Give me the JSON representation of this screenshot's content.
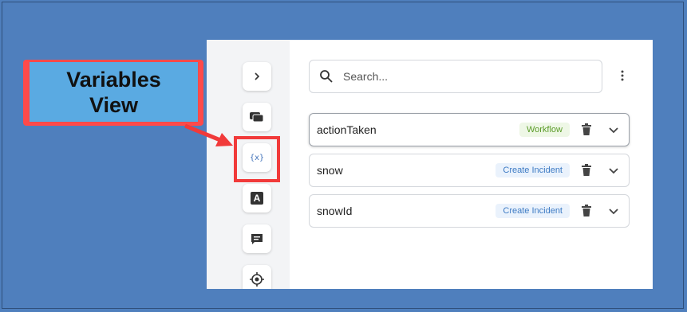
{
  "callout": {
    "line1": "Variables",
    "line2": "View"
  },
  "rail": {
    "items": [
      {
        "icon": "chevron-right-icon"
      },
      {
        "icon": "chat-bubbles-icon"
      },
      {
        "icon": "variables-icon",
        "label": "{x}"
      },
      {
        "icon": "text-a-icon",
        "label": "A"
      },
      {
        "icon": "message-icon"
      },
      {
        "icon": "target-icon"
      }
    ]
  },
  "search": {
    "placeholder": "Search..."
  },
  "variables": [
    {
      "name": "actionTaken",
      "badge": "Workflow"
    },
    {
      "name": "snow",
      "badge": "Create Incident"
    },
    {
      "name": "snowId",
      "badge": "Create Incident"
    }
  ],
  "colors": {
    "background": "#4f7fbd",
    "callout_border": "#ff4a4a",
    "callout_fill": "#5aaae2",
    "workflow_badge": "#5c9c2a",
    "incident_badge": "#3d7bc4"
  }
}
